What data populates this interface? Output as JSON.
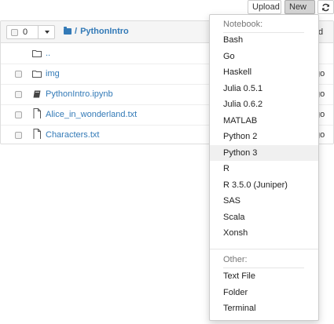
{
  "toolbar": {
    "upload_label": "Upload",
    "new_label": "New",
    "refresh_icon": "refresh-icon"
  },
  "file_list": {
    "selected_count": "0",
    "breadcrumb_sep": "/",
    "breadcrumb_folder": "PythonIntro",
    "header_right": "d",
    "rows": [
      {
        "name": "..",
        "type": "folder",
        "modified": ""
      },
      {
        "name": "img",
        "type": "folder",
        "modified": "go"
      },
      {
        "name": "PythonIntro.ipynb",
        "type": "notebook",
        "modified": "go"
      },
      {
        "name": "Alice_in_wonderland.txt",
        "type": "file",
        "modified": "go"
      },
      {
        "name": "Characters.txt",
        "type": "file",
        "modified": "go"
      }
    ]
  },
  "new_menu": {
    "notebook_header": "Notebook:",
    "notebook_items": [
      "Bash",
      "Go",
      "Haskell",
      "Julia 0.5.1",
      "Julia 0.6.2",
      "MATLAB",
      "Python 2",
      "Python 3",
      "R",
      "R 3.5.0 (Juniper)",
      "SAS",
      "Scala",
      "Xonsh"
    ],
    "highlighted_item": "Python 3",
    "other_header": "Other:",
    "other_items": [
      "Text File",
      "Folder",
      "Terminal"
    ]
  },
  "colors": {
    "link": "#337ab7",
    "new_button_active": "#d4d4d4"
  }
}
